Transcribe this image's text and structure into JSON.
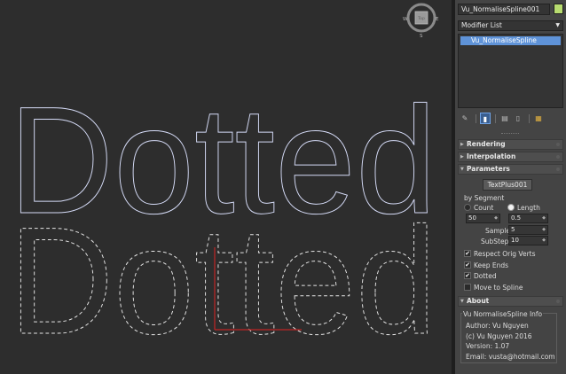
{
  "viewport": {
    "text_solid": "Dotted",
    "text_dotted": "Dotted",
    "viewcube": {
      "face_label": "Top",
      "west": "W",
      "east": "E",
      "south": "S"
    }
  },
  "panel": {
    "object_name": "Vu_NormaliseSpline001",
    "object_color": "#b8dc70",
    "modifier_list_label": "Modifier List",
    "stack_items": [
      "Vu_NormaliseSpline"
    ],
    "stack_buttons": [
      "pin-icon",
      "show-end-result-icon",
      "make-unique-icon",
      "remove-modifier-icon",
      "configure-sets-icon"
    ]
  },
  "rollouts": {
    "rendering": "Rendering",
    "interpolation": "Interpolation",
    "parameters": "Parameters",
    "about": "About"
  },
  "params": {
    "object_button": "TextPlus001",
    "by_segment_label": "by Segment",
    "count_label": "Count",
    "length_label": "Length",
    "count_value": "50",
    "length_value": "0.5",
    "samples_label": "Samples",
    "samples_value": "5",
    "substeps_label": "SubSteps",
    "substeps_value": "10",
    "selected_mode": "Length",
    "checkboxes": [
      {
        "label": "Respect Orig Verts",
        "checked": true
      },
      {
        "label": "Keep Ends",
        "checked": true
      },
      {
        "label": "Dotted",
        "checked": true
      },
      {
        "label": "Move to Spline",
        "checked": false
      }
    ]
  },
  "about": {
    "group_title": "Vu NormaliseSpline Info",
    "lines": [
      "Author: Vu Nguyen",
      "(c) Vu Nguyen 2016",
      "Version: 1.07",
      "Email: vusta@hotmail.com"
    ]
  },
  "colors": {
    "selection_blue": "#5f93d8",
    "spline_solid": "#d6dcf8",
    "spline_dotted": "#e6e6e6",
    "gizmo_red": "#c02424"
  }
}
